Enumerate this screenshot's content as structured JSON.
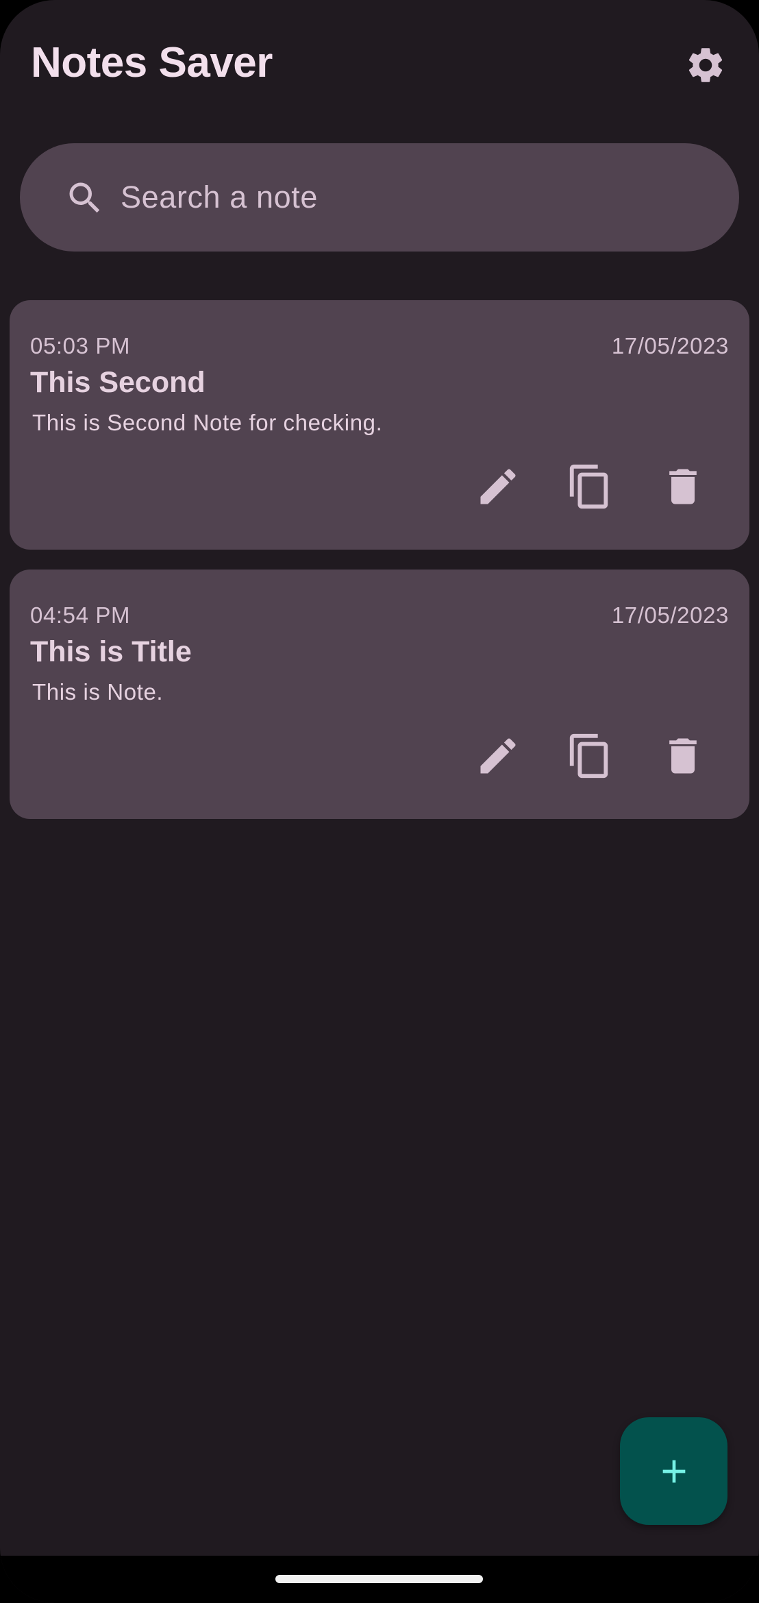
{
  "header": {
    "title": "Notes Saver",
    "settings_icon": "gear-icon"
  },
  "search": {
    "placeholder": "Search a note",
    "value": "",
    "icon": "search-icon"
  },
  "notes": [
    {
      "time": "05:03 PM",
      "date": "17/05/2023",
      "title": "This Second",
      "body": "This is Second Note for checking.",
      "actions": [
        "edit-icon",
        "copy-icon",
        "delete-icon"
      ]
    },
    {
      "time": "04:54 PM",
      "date": "17/05/2023",
      "title": "This is Title",
      "body": "This is Note.",
      "actions": [
        "edit-icon",
        "copy-icon",
        "delete-icon"
      ]
    }
  ],
  "fab": {
    "icon": "add-icon"
  },
  "colors": {
    "background": "#201a20",
    "surface": "#514350",
    "on_surface": "#e6d2e0",
    "on_surface_variant": "#d6c2d2",
    "fab_background": "#03524d",
    "fab_icon": "#76f2e6"
  }
}
